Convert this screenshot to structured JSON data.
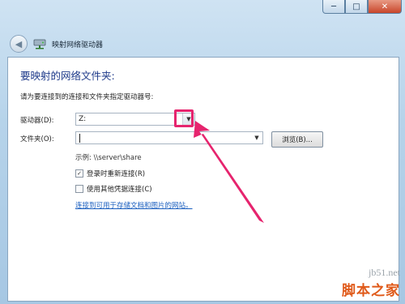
{
  "window": {
    "title": "映射网络驱动器",
    "controls": {
      "minimize": "─",
      "maximize": "□",
      "close": "✕"
    }
  },
  "content": {
    "heading": "要映射的网络文件夹:",
    "instruction": "请为要连接到的连接和文件夹指定驱动器号:",
    "drive": {
      "label": "驱动器(D):",
      "value": "Z:"
    },
    "folder": {
      "label": "文件夹(O):",
      "value": ""
    },
    "browse_label": "浏览(B)...",
    "example": "示例: \\\\server\\share",
    "reconnect": {
      "label": "登录时重新连接(R)",
      "checked": true
    },
    "other_credentials": {
      "label": "使用其他凭据连接(C)",
      "checked": false
    },
    "link": "连接到可用于存储文档和图片的网站。"
  },
  "watermark": {
    "url": "jb51.net",
    "brand": "脚本之家"
  },
  "colors": {
    "heading": "#1e3a8a",
    "link": "#1b5fbf",
    "highlight": "#e6246e",
    "brand": "#e05a1a"
  },
  "icons": [
    "back-arrow-icon",
    "network-drive-icon",
    "dropdown-arrow-icon",
    "checkmark-icon"
  ]
}
